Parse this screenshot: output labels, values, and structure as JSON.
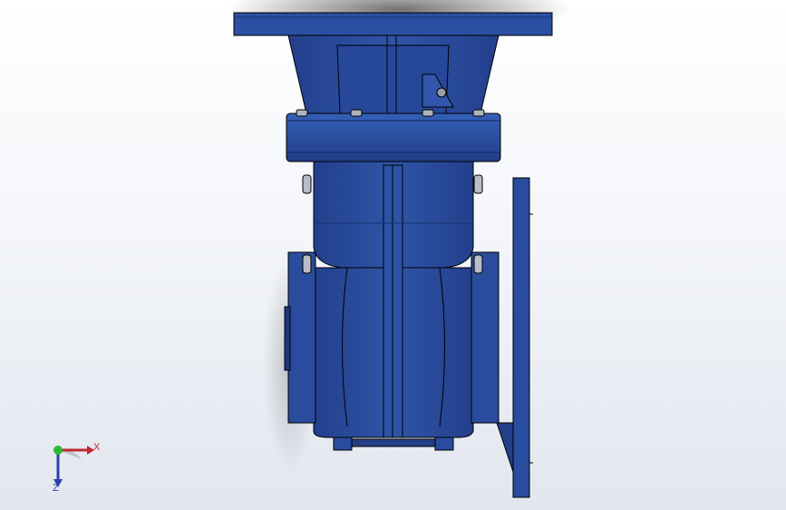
{
  "viewport": {
    "background_top": "#ffffff",
    "background_bottom": "#e2e6ee"
  },
  "model": {
    "description_icon": "gearbox-model",
    "body_color": "#2c4fa0",
    "body_dark": "#1d3880",
    "body_light": "#3a63bf",
    "edge_color": "#000000",
    "bolt_color": "#b8bcc4"
  },
  "triad": {
    "x_label": "X",
    "z_label": "Z",
    "x_color": "#c0282d",
    "y_color": "#2eb82e",
    "z_color": "#2c3fae"
  }
}
